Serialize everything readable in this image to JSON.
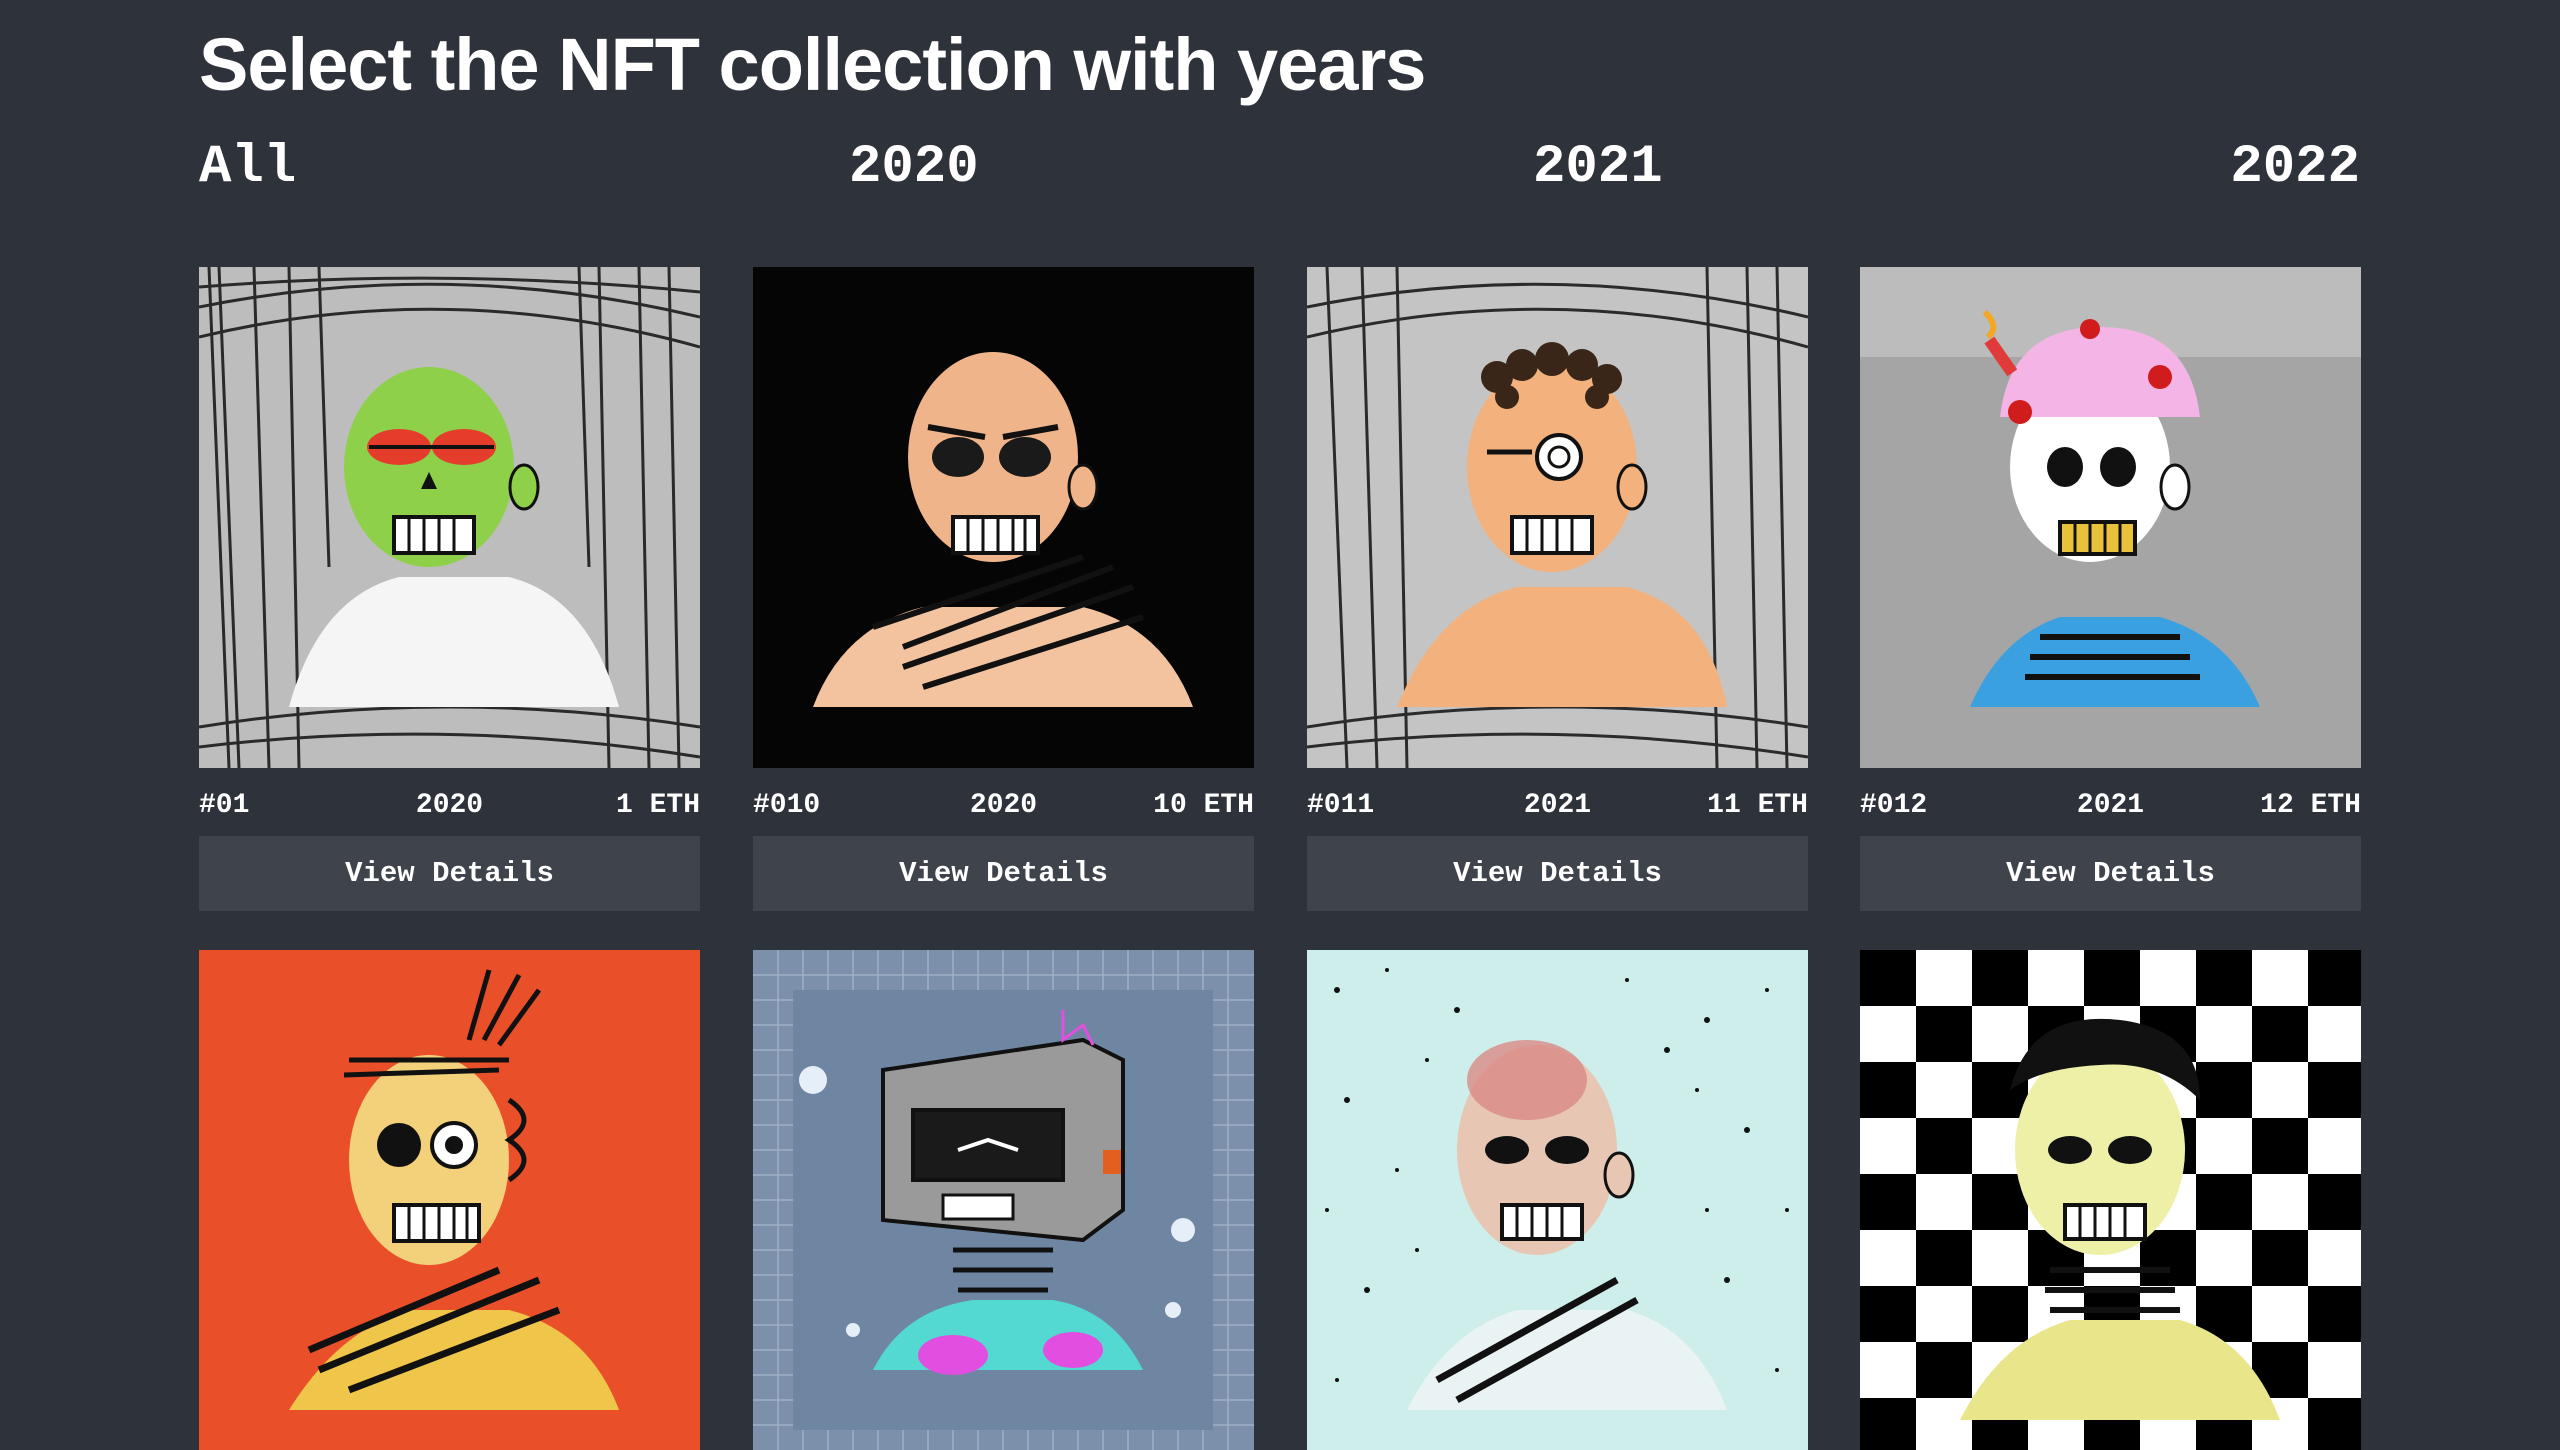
{
  "page": {
    "title": "Select the NFT collection with years"
  },
  "filters": [
    {
      "label": "All"
    },
    {
      "label": "2020"
    },
    {
      "label": "2021"
    },
    {
      "label": "2022"
    }
  ],
  "cards": [
    {
      "id": "#01",
      "year": "2020",
      "price": "1 ETH",
      "button": "View Details",
      "art": "green-skull-on-scribble-portrait"
    },
    {
      "id": "#010",
      "year": "2020",
      "price": "10 ETH",
      "button": "View Details",
      "art": "bald-skull-on-black-portrait"
    },
    {
      "id": "#011",
      "year": "2021",
      "price": "11 ETH",
      "button": "View Details",
      "art": "curly-hair-skull-portrait"
    },
    {
      "id": "#012",
      "year": "2021",
      "price": "12 ETH",
      "button": "View Details",
      "art": "cake-head-skull-portrait"
    },
    {
      "id": "",
      "year": "",
      "price": "",
      "button": "",
      "art": "orange-background-skull-portrait"
    },
    {
      "id": "",
      "year": "",
      "price": "",
      "button": "",
      "art": "robot-box-head-skull-portrait"
    },
    {
      "id": "",
      "year": "",
      "price": "",
      "button": "",
      "art": "speckled-mint-skull-portrait"
    },
    {
      "id": "",
      "year": "",
      "price": "",
      "button": "",
      "art": "checkerboard-skull-portrait"
    }
  ],
  "colors": {
    "background": "#2e323a",
    "button_bg": "#3f434c",
    "text": "#ffffff"
  }
}
